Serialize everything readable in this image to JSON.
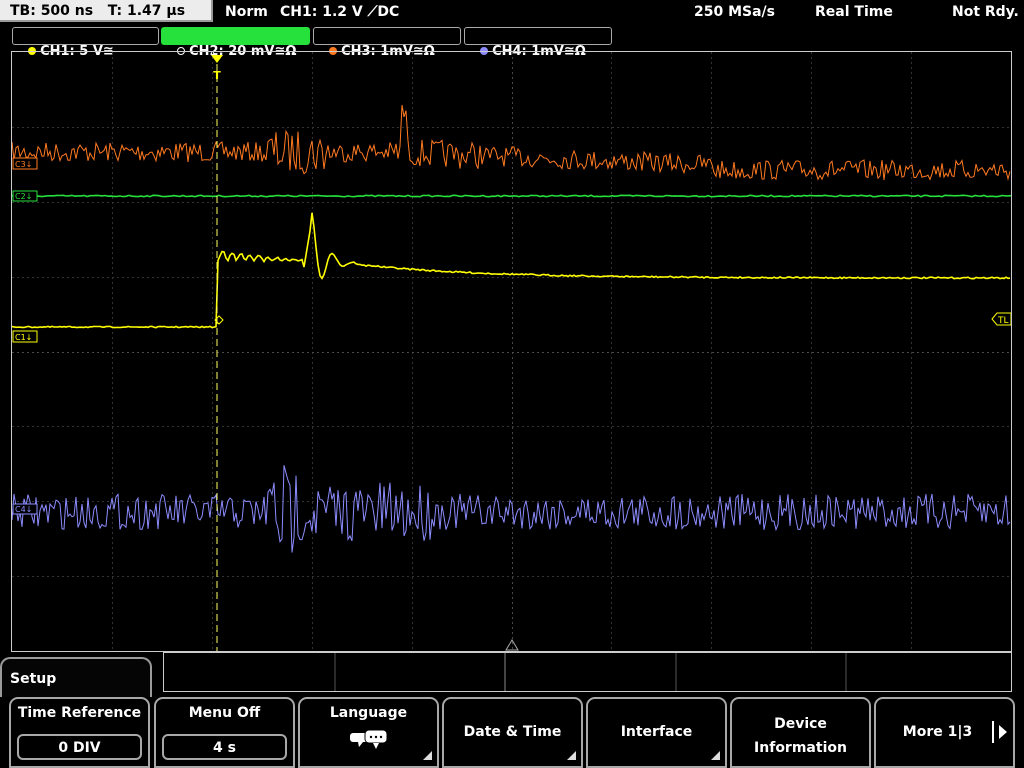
{
  "status": {
    "timebase": "TB: 500 ns   T: 1.47 µs",
    "trigger_mode": "Norm",
    "trigger_source": "CH1: 1.2 V ⟋DC",
    "sample_rate": "250 MSa/s",
    "acq_mode": "Real Time",
    "state": "Not Rdy."
  },
  "channels": [
    {
      "label": "CH1: 5 V≅",
      "color": "#ffff00"
    },
    {
      "label": "CH2: 20 mV≅Ω",
      "color": "#26e03c"
    },
    {
      "label": "CH3: 1mV≅Ω",
      "color": "#ff7a21"
    },
    {
      "label": "CH4: 1mV≅Ω",
      "color": "#8c8cff"
    }
  ],
  "markers": {
    "ch3": "C3↓",
    "ch2": "C2↓",
    "ch1": "C1↓",
    "ch4": "C4↓",
    "trigger_level": "TL",
    "trigger_pos": "T"
  },
  "menu": {
    "title": "Setup",
    "softkeys": [
      {
        "label": "Time Reference",
        "value": "0 DIV"
      },
      {
        "label": "Menu Off",
        "value": "4 s"
      },
      {
        "label": "Language",
        "icon": "speech-bubbles-icon"
      },
      {
        "label": "Date & Time"
      },
      {
        "label": "Interface"
      },
      {
        "label": "Device\nInformation"
      },
      {
        "label": "More 1|3"
      }
    ]
  },
  "colors": {
    "ch1": "#ffff00",
    "ch2": "#26e03c",
    "ch3": "#ff7a21",
    "ch4": "#8c8cff",
    "grid": "#3a3a3a",
    "active_tab": "#26e03c"
  }
}
